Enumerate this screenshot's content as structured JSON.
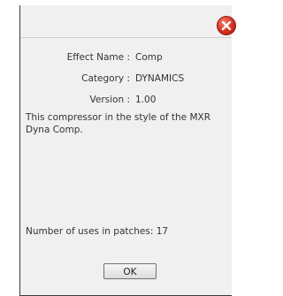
{
  "dialog": {
    "fields": [
      {
        "label": "Effect Name :",
        "value": "Comp"
      },
      {
        "label": "Category :",
        "value": "DYNAMICS"
      },
      {
        "label": "Version :",
        "value": "1.00"
      }
    ],
    "description": "This compressor in the style of the MXR Dyna Comp.",
    "uses_text": "Number of uses in patches: 17",
    "ok_label": "OK",
    "close_icon": "close-icon"
  },
  "colors": {
    "background": "#f0f0f0",
    "close_red": "#d8301e",
    "text": "#333333"
  }
}
